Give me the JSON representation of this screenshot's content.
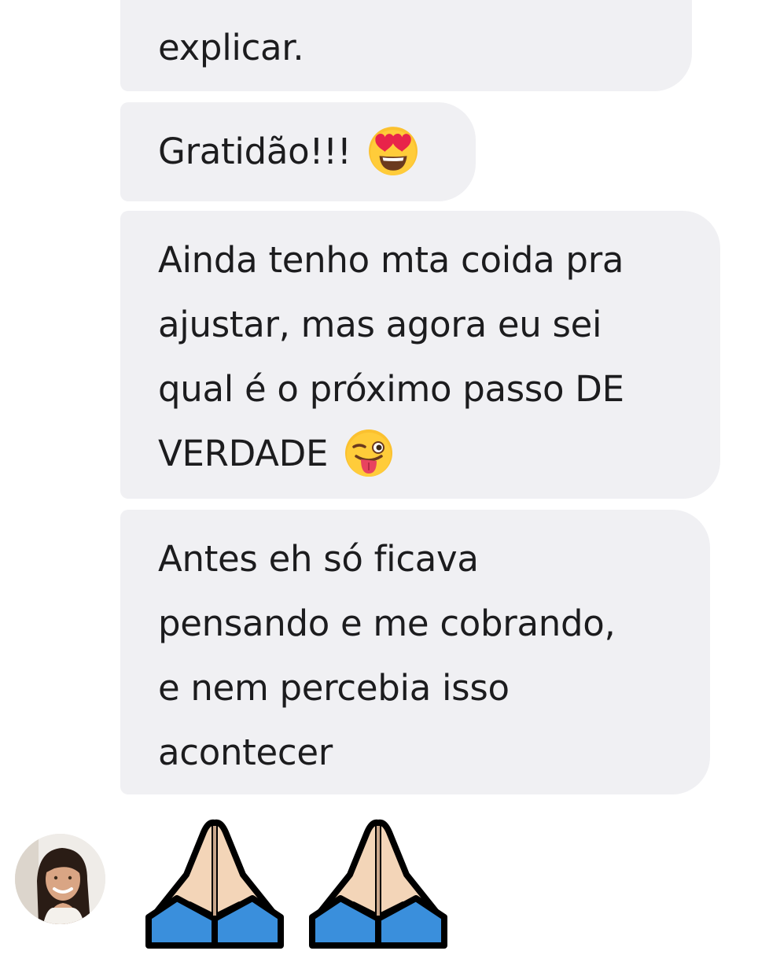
{
  "messages": [
    {
      "lines": [
        "explicar."
      ]
    },
    {
      "lines": [
        "Gratidão!!!"
      ],
      "emoji": "heart-eyes-emoji"
    },
    {
      "lines": [
        "Ainda tenho mta coida pra",
        "ajustar, mas agora eu sei",
        "qual é o próximo passo DE",
        "VERDADE"
      ],
      "emoji": "winking-tongue-emoji"
    },
    {
      "lines": [
        "Antes eh só ficava",
        "pensando e me cobrando,",
        "e nem percebia isso",
        "acontecer"
      ]
    }
  ],
  "last_message": {
    "emojis": [
      "folded-hands-emoji",
      "folded-hands-emoji"
    ]
  },
  "sender": {
    "avatar": "avatar-photo-woman"
  },
  "colors": {
    "bubble_background": "#f0f0f3",
    "text": "#1c1c1e",
    "sleeve": "#3a8fdc",
    "skin": "#f3d5b8"
  }
}
